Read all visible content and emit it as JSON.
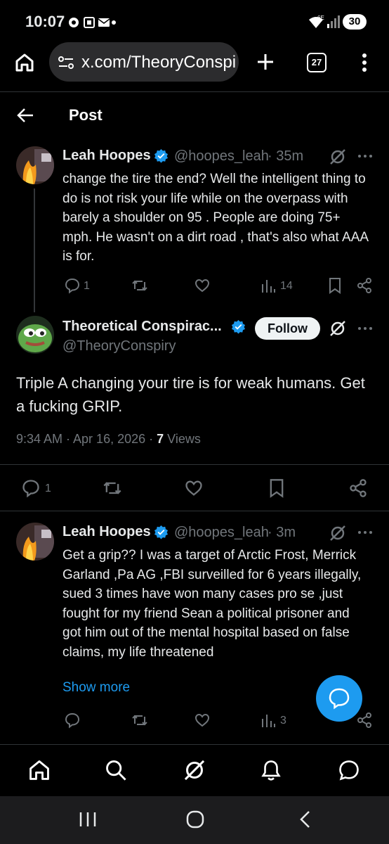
{
  "status_bar": {
    "time": "10:07",
    "network_label": "6E",
    "battery": "30"
  },
  "browser": {
    "url": "x.com/TheoryConspi",
    "tab_count": "27"
  },
  "header": {
    "title": "Post"
  },
  "parent_tweet": {
    "name": "Leah Hoopes",
    "handle": "@hoopes_leah",
    "time": "· 35m",
    "text": "change the tire the end? Well the intelligent thing to do is not risk your life while on the overpass with barely a shoulder on 95 . People are doing 75+ mph. He wasn't on a dirt road , that's also what AAA is for.",
    "replies": "1",
    "views": "14"
  },
  "main_tweet": {
    "name": "Theoretical Conspirac...",
    "handle": "@TheoryConspiry",
    "follow_label": "Follow",
    "text": "Triple A changing your tire is for weak humans. Get a fucking GRIP.",
    "timestamp": "9:34 AM · Apr 16, 2026 · ",
    "views_count": "7",
    "views_label": " Views",
    "replies": "1"
  },
  "reply_tweet": {
    "name": "Leah Hoopes",
    "handle": "@hoopes_leah",
    "time": "· 3m",
    "text": "Get a grip?? I was a target of Arctic Frost, Merrick Garland ,Pa AG ,FBI surveilled for 6 years illegally, sued 3 times have won many cases pro se ,just fought for my friend Sean a political prisoner and got him out of the mental hospital based on false claims, my life threatened",
    "show_more": "Show more",
    "views": "3"
  },
  "colors": {
    "accent": "#1d9bf0",
    "background": "#000000",
    "muted": "#71767b",
    "text": "#e7e9ea"
  }
}
